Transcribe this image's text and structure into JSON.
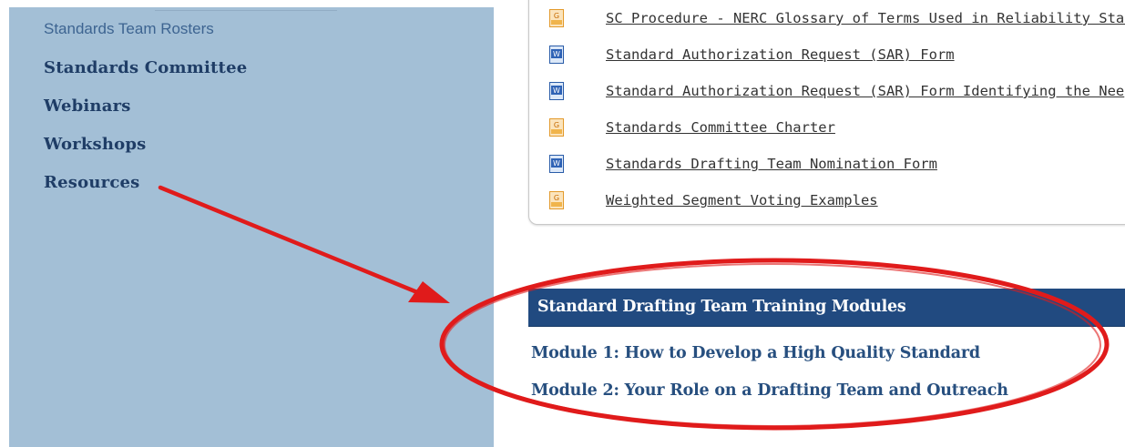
{
  "sidebar": {
    "sub_item": "Standards Team Rosters",
    "items": [
      {
        "label": "Standards Committee"
      },
      {
        "label": "Webinars"
      },
      {
        "label": "Workshops"
      },
      {
        "label": "Resources"
      }
    ]
  },
  "documents": [
    {
      "icon": "pdf-icon",
      "label": "SC Procedure - NERC Glossary of Terms Used in Reliability Stan"
    },
    {
      "icon": "word-icon",
      "label": "Standard Authorization Request (SAR) Form"
    },
    {
      "icon": "word-icon",
      "label": "Standard Authorization Request (SAR) Form Identifying the Nee"
    },
    {
      "icon": "pdf-icon",
      "label": "Standards Committee Charter"
    },
    {
      "icon": "word-icon",
      "label": "Standards Drafting Team Nomination Form"
    },
    {
      "icon": "pdf-icon",
      "label": "Weighted Segment Voting Examples"
    }
  ],
  "training": {
    "header": "Standard Drafting Team Training Modules",
    "modules": [
      {
        "label": "Module 1: How to Develop a High Quality Standard"
      },
      {
        "label": "Module 2: Your Role on a Drafting Team and Outreach"
      }
    ]
  },
  "colors": {
    "sidebar_bg": "#a3bfd6",
    "header_bg": "#214a80",
    "link": "#274f7f",
    "annotation": "#e01b1b"
  }
}
